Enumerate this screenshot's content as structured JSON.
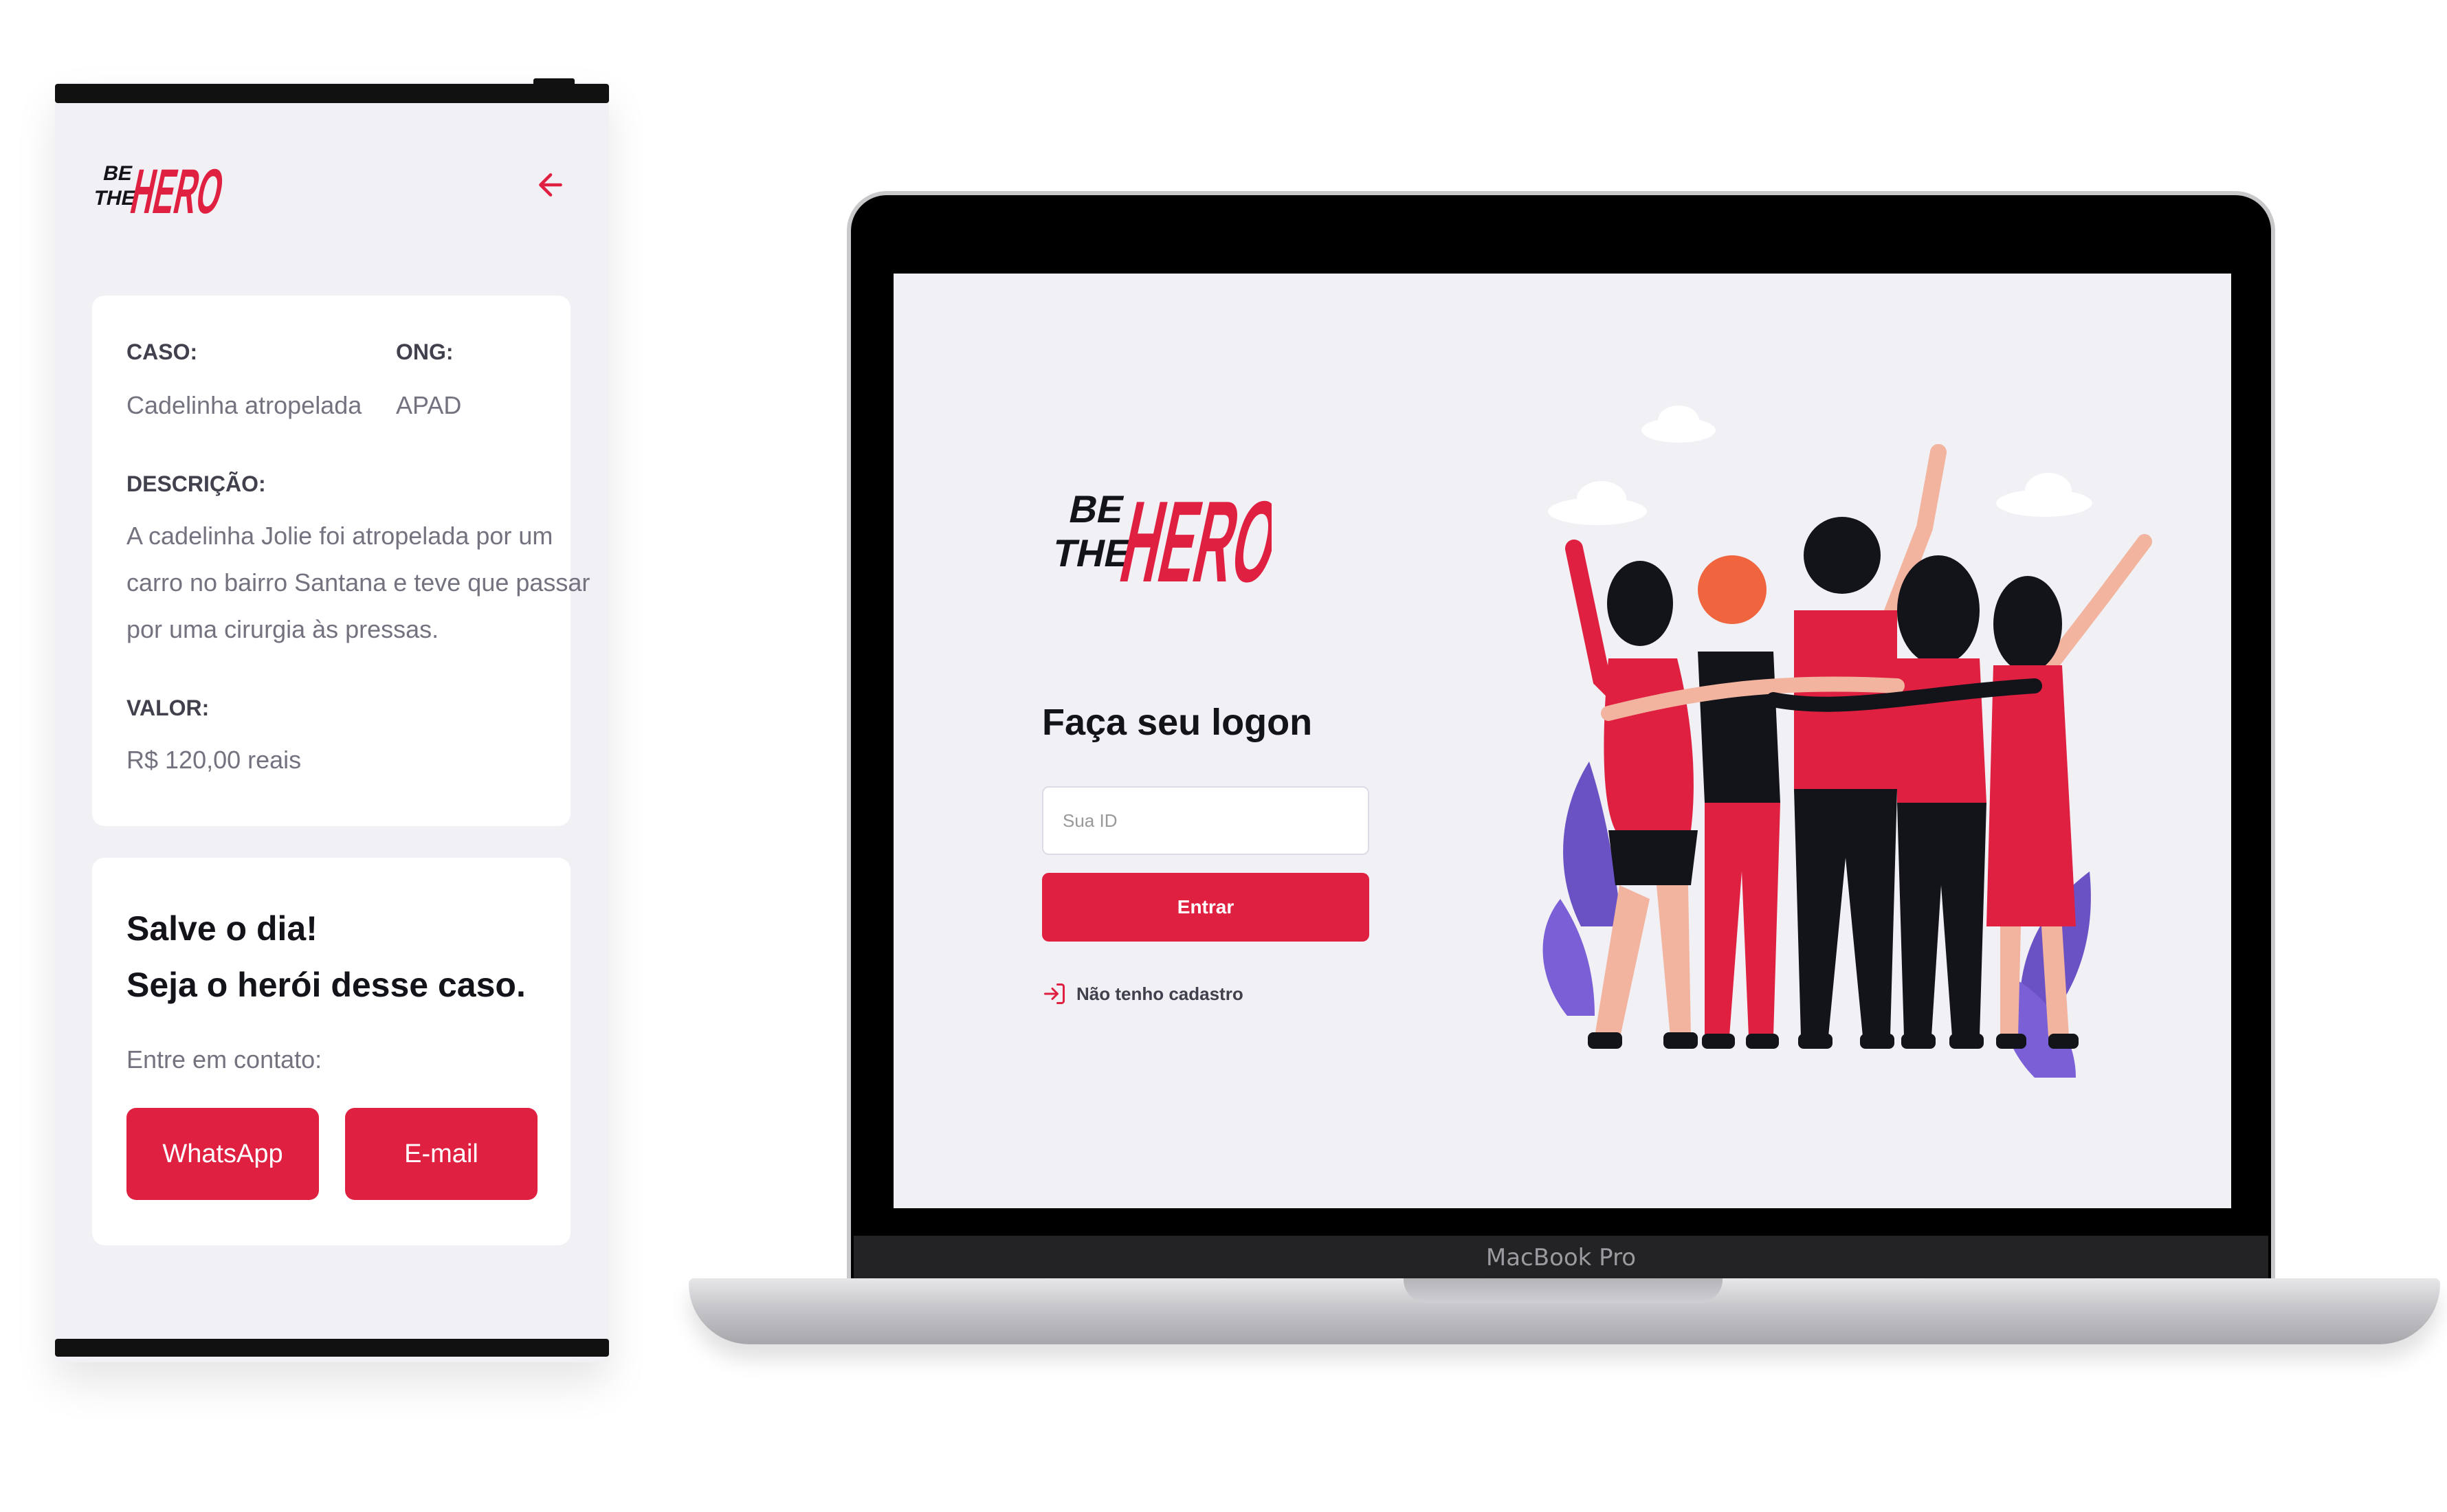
{
  "brand": {
    "logo_text_small": "BE THE",
    "logo_text_big": "HERO",
    "accent_color": "#e02041",
    "icon": "hero-logo"
  },
  "phone": {
    "back_icon": "arrow-left-icon",
    "incident": {
      "case_label": "CASO:",
      "case_value": "Cadelinha atropelada",
      "ong_label": "ONG:",
      "ong_value": "APAD",
      "description_label": "DESCRIÇÃO:",
      "description_lines": [
        "A cadelinha Jolie foi atropelada por um",
        "carro no bairro Santana e teve que passar",
        "por uma cirurgia às pressas."
      ],
      "value_label": "VALOR:",
      "value_value": "R$ 120,00 reais"
    },
    "contact": {
      "title_line1": "Salve o dia!",
      "title_line2": "Seja o herói desse caso.",
      "subtitle": "Entre em contato:",
      "whatsapp_label": "WhatsApp",
      "email_label": "E-mail"
    }
  },
  "laptop": {
    "model_label": "MacBook Pro",
    "logon": {
      "title": "Faça seu logon",
      "id_placeholder": "Sua ID",
      "submit_label": "Entrar",
      "register_link": "Não tenho cadastro",
      "register_icon": "log-in-icon"
    },
    "illustration": "heroes-group-illustration"
  }
}
